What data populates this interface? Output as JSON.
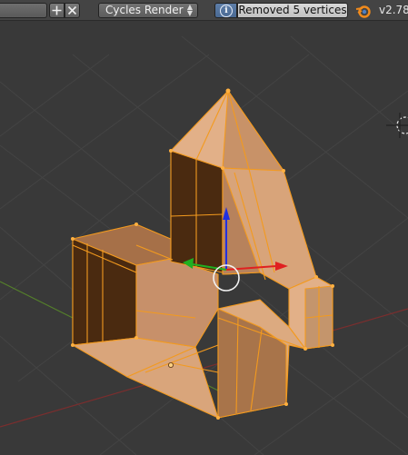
{
  "header": {
    "scene_field": "",
    "add_icon": "plus-icon",
    "remove_icon": "x-icon",
    "render_engine": "Cycles Render",
    "info_icon": "info-icon",
    "report_message": "Removed 5 vertices",
    "logo_icon": "blender-logo-icon",
    "version": "v2.78"
  },
  "viewport": {
    "mode": "edit-mode",
    "colors": {
      "background": "#393939",
      "grid": "#434343",
      "x_axis": "#8a3030",
      "y_axis": "#5d8a2a",
      "face": "#d8a070",
      "face_dark": "#4a2a10",
      "edge": "#ff9a1a",
      "gizmo_x": "#e02020",
      "gizmo_y": "#20b020",
      "gizmo_z": "#2020e0"
    }
  }
}
